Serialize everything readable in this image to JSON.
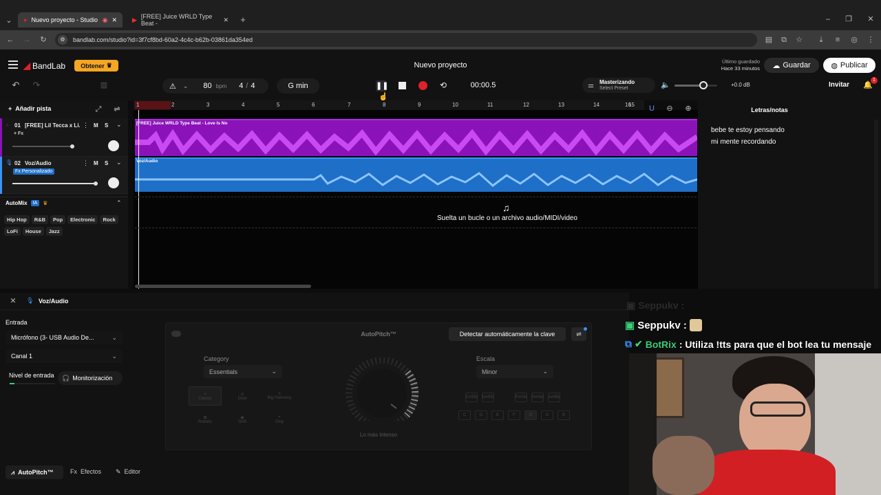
{
  "browser": {
    "tabs": [
      {
        "label": "Nuevo proyecto - Studio",
        "active": true
      },
      {
        "label": "[FREE] Juice WRLD Type Beat -",
        "active": false
      }
    ],
    "url": "bandlab.com/studio?id=3f7cf8bd-60a2-4c4c-b62b-03861da354ed"
  },
  "app": {
    "brand": "BandLab",
    "get_button": "Obtener",
    "project_title": "Nuevo proyecto",
    "last_saved_label": "Último guardado",
    "last_saved_time": "Hace 33 minutos",
    "save_button": "Guardar",
    "publish_button": "Publicar",
    "invite_button": "Invitar",
    "notification_count": "1"
  },
  "toolbar": {
    "tempo_value": "80",
    "tempo_unit": "bpm",
    "time_sig_num": "4",
    "time_sig_sep": "/",
    "time_sig_den": "4",
    "key": "G min",
    "time": "00:00.5",
    "mastering_label": "Masterizando",
    "mastering_preset": "Select Preset",
    "volume_db": "+0.0 dB"
  },
  "tracks": {
    "add_track": "Añadir pista",
    "list": [
      {
        "number": "01",
        "name": "[FREE] Lil Tecca x Li...",
        "fx": "+ Fx",
        "m": "M",
        "s": "S"
      },
      {
        "number": "02",
        "name": "Voz/Audio",
        "fx": "Fx Personalizado",
        "m": "M",
        "s": "S"
      }
    ],
    "automix_label": "AutoMix",
    "automix_badge": "IA",
    "genres": [
      "Hip Hop",
      "R&B",
      "Pop",
      "Electronic",
      "Rock",
      "LoFi",
      "House",
      "Jazz"
    ]
  },
  "timeline": {
    "bars": [
      "1",
      "2",
      "3",
      "4",
      "5",
      "6",
      "7",
      "8",
      "9",
      "10",
      "11",
      "12",
      "13",
      "14",
      "15",
      "16"
    ],
    "clip1_label": "[FREE] Juice WRLD Type Beat - Love Is No",
    "clip2_label": "Voz/Audio",
    "drop_hint": "Suelta un bucle o un archivo audio/MIDI/video"
  },
  "notes": {
    "title": "Letras/notas",
    "lines": [
      "bebe te estoy pensando",
      "mi mente recordando"
    ]
  },
  "panel": {
    "track_name": "Voz/Audio",
    "input_label": "Entrada",
    "input_device": "Micrófono (3- USB Audio De...",
    "channel": "Canal 1",
    "input_level_label": "Nivel de entrada",
    "monitor_button": "Monitorización",
    "autopitch_title": "AutoPitch™",
    "detect_key_button": "Detectar automáticamente la clave",
    "category_label": "Category",
    "category_value": "Essentials",
    "scale_label": "Escala",
    "scale_value": "Minor",
    "presets_row1": [
      "Classic",
      "Duet",
      "Big Harmony"
    ],
    "presets_row2": [
      "Robotic",
      "Shift",
      "Chip"
    ],
    "knob_caption": "Lo más intenso",
    "sharp_keys": [
      "C#/Db",
      "D#/Eb",
      "F#/Gb",
      "G#/Ab",
      "A#/Bb"
    ],
    "natural_keys": [
      "C",
      "D",
      "E",
      "F",
      "G",
      "A",
      "B"
    ],
    "bottom_tabs": [
      "AutoPitch™",
      "Efectos",
      "Editor"
    ]
  },
  "stream": {
    "ghost_user": "Seppukv :",
    "user": "Seppukv :",
    "bot_name": "BotRix",
    "bot_message": ": Utiliza !tts para que el bot lea tu mensaje"
  },
  "colors": {
    "accent_red": "#e0202a",
    "purple_clip": "#8a12b8",
    "blue_clip": "#1e6fc8",
    "get_orange": "#f5a623"
  }
}
